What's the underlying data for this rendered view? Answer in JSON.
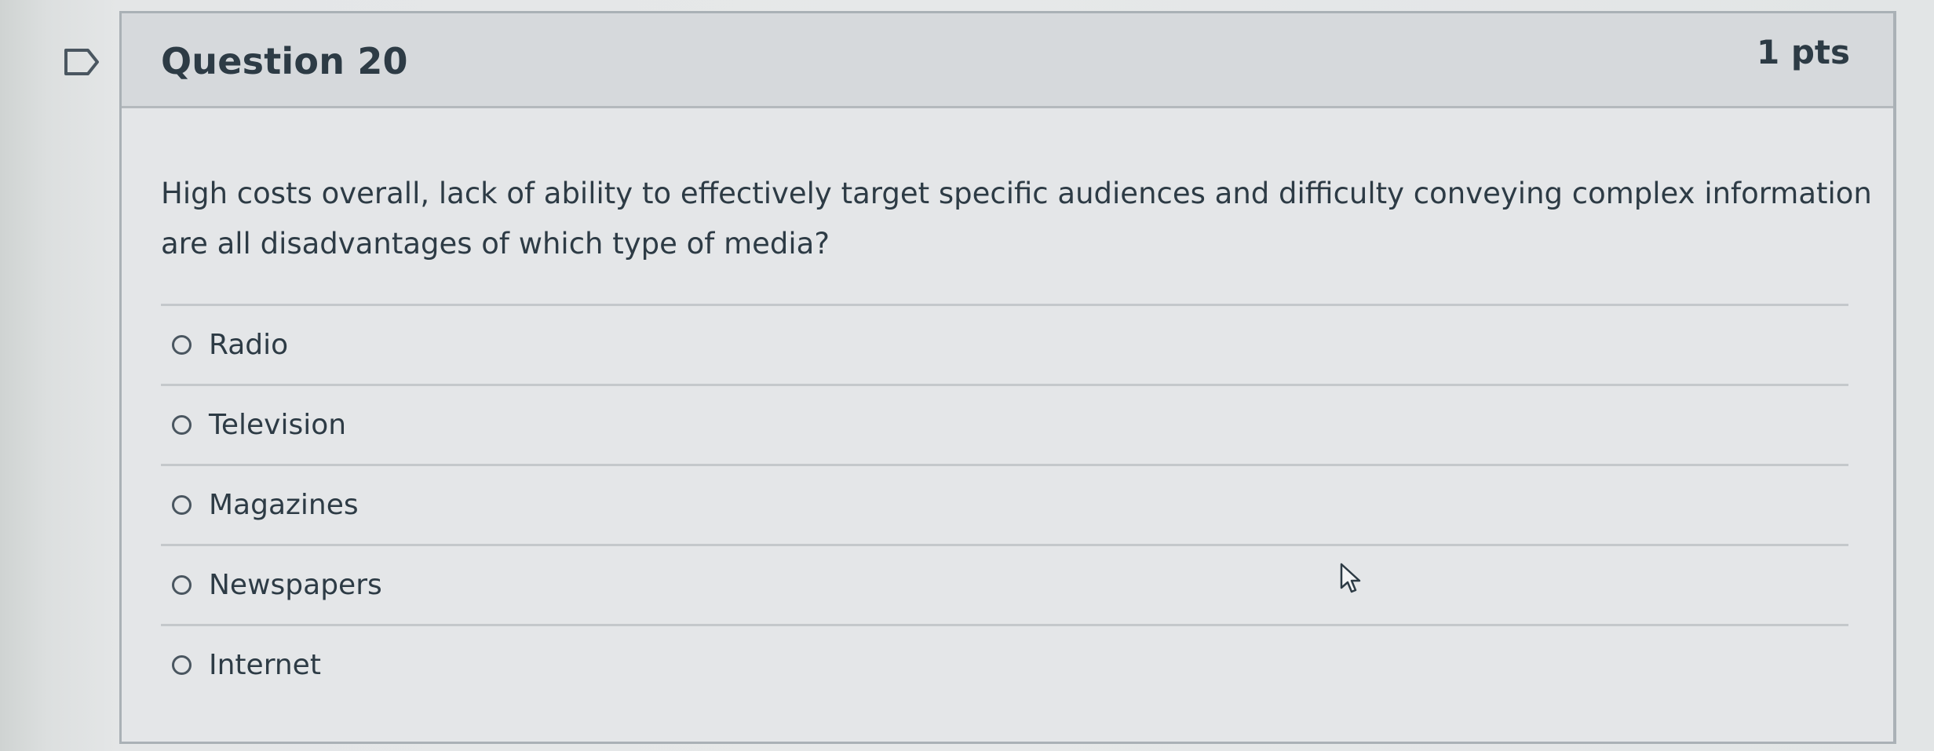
{
  "question": {
    "title": "Question 20",
    "points": "1 pts",
    "text": "High costs overall, lack of ability to effectively target specific audiences and difficulty conveying complex information are all disadvantages of which type of media?"
  },
  "answers": [
    {
      "label": "Radio"
    },
    {
      "label": "Television"
    },
    {
      "label": "Magazines"
    },
    {
      "label": "Newspapers"
    },
    {
      "label": "Internet"
    }
  ],
  "icons": {
    "flag": "bookmark-flag-icon",
    "radio": "radio-button-icon",
    "cursor": "mouse-pointer-icon"
  },
  "colors": {
    "text": "#2d3b45",
    "header_bg": "#d6d9dc",
    "card_bg": "#e4e6e8",
    "border": "#aab1b6"
  }
}
